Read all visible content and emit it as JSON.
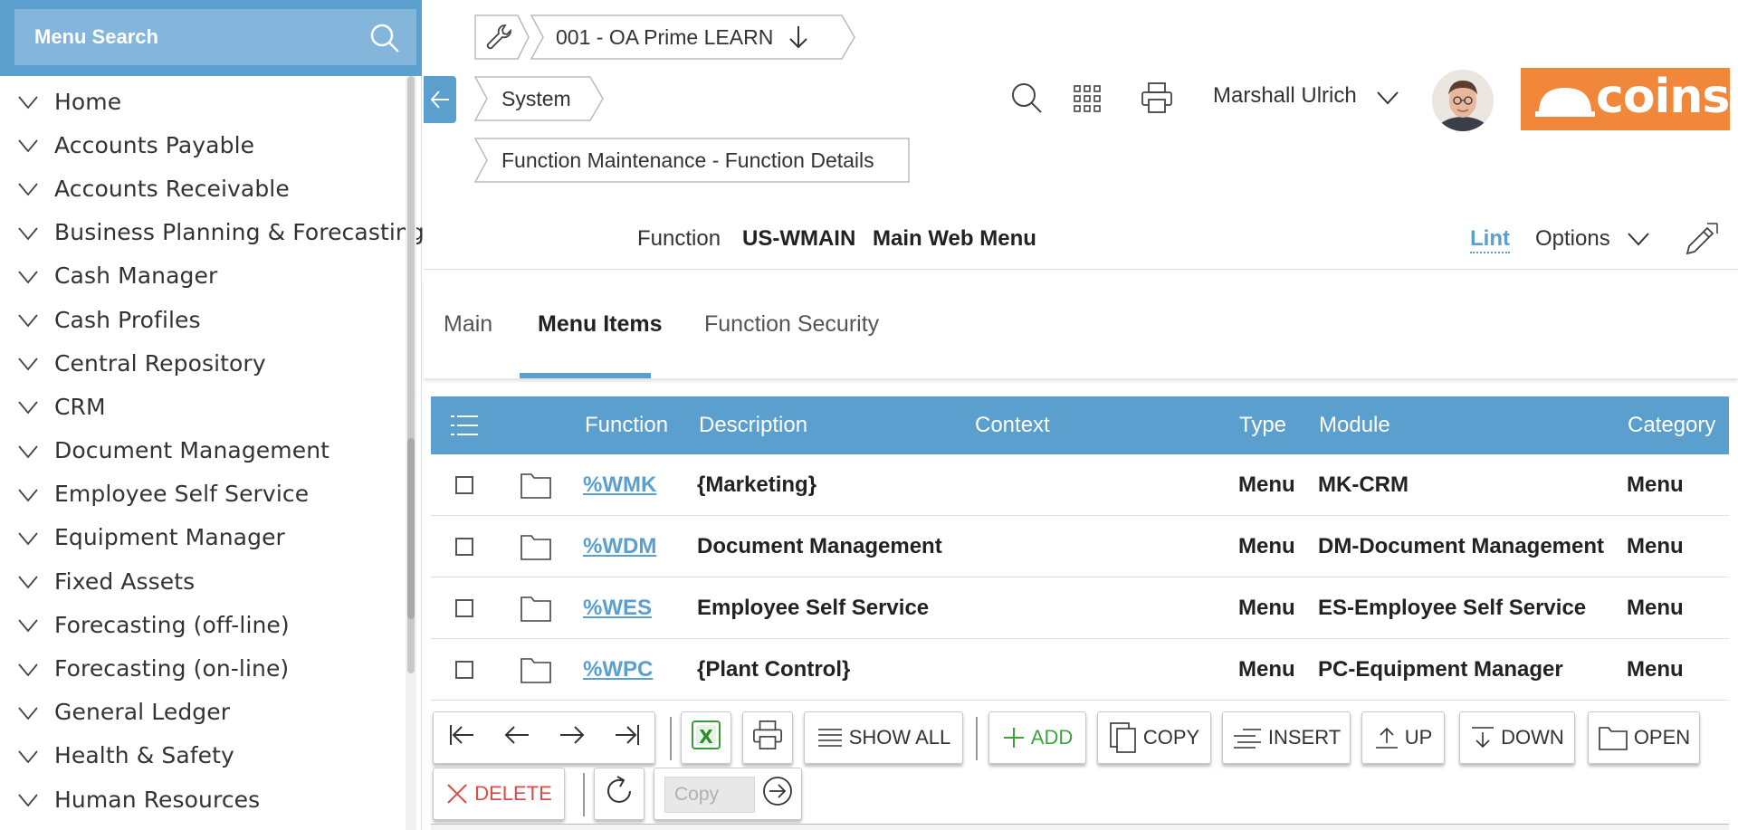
{
  "sidebar": {
    "search_placeholder": "Menu Search",
    "items": [
      {
        "label": "Home"
      },
      {
        "label": "Accounts Payable"
      },
      {
        "label": "Accounts Receivable"
      },
      {
        "label": "Business Planning & Forecasting"
      },
      {
        "label": "Cash Manager"
      },
      {
        "label": "Cash Profiles"
      },
      {
        "label": "Central Repository"
      },
      {
        "label": "CRM"
      },
      {
        "label": "Document Management"
      },
      {
        "label": "Employee Self Service"
      },
      {
        "label": "Equipment Manager"
      },
      {
        "label": "Fixed Assets"
      },
      {
        "label": "Forecasting (off-line)"
      },
      {
        "label": "Forecasting (on-line)"
      },
      {
        "label": "General Ledger"
      },
      {
        "label": "Health & Safety"
      },
      {
        "label": "Human Resources"
      }
    ]
  },
  "breadcrumb": {
    "company": "001 - OA Prime LEARN",
    "module": "System",
    "page": "Function Maintenance - Function Details"
  },
  "header": {
    "user_name": "Marshall Ulrich",
    "logo_text": "coins",
    "brand_color": "#f0873a",
    "accent_color": "#5b9fce"
  },
  "function": {
    "label": "Function",
    "code": "US-WMAIN",
    "description": "Main Web Menu",
    "lint_label": "Lint",
    "options_label": "Options"
  },
  "tabs": [
    {
      "label": "Main",
      "active": false
    },
    {
      "label": "Menu Items",
      "active": true
    },
    {
      "label": "Function Security",
      "active": false
    }
  ],
  "grid": {
    "columns": [
      "Function",
      "Description",
      "Context",
      "Type",
      "Module",
      "Category"
    ],
    "rows": [
      {
        "function": "%WMK",
        "description": "{Marketing}",
        "context": "",
        "type": "Menu",
        "module": "MK-CRM",
        "category": "Menu"
      },
      {
        "function": "%WDM",
        "description": "Document Management",
        "context": "",
        "type": "Menu",
        "module": "DM-Document Management",
        "category": "Menu"
      },
      {
        "function": "%WES",
        "description": "Employee Self Service",
        "context": "",
        "type": "Menu",
        "module": "ES-Employee Self Service",
        "category": "Menu"
      },
      {
        "function": "%WPC",
        "description": "{Plant Control}",
        "context": "",
        "type": "Menu",
        "module": "PC-Equipment Manager",
        "category": "Menu"
      }
    ]
  },
  "toolbar": {
    "show_all": "SHOW ALL",
    "add": "ADD",
    "copy": "COPY",
    "insert": "INSERT",
    "up": "UP",
    "down": "DOWN",
    "open": "OPEN",
    "delete": "DELETE",
    "copy_placeholder": "Copy"
  }
}
